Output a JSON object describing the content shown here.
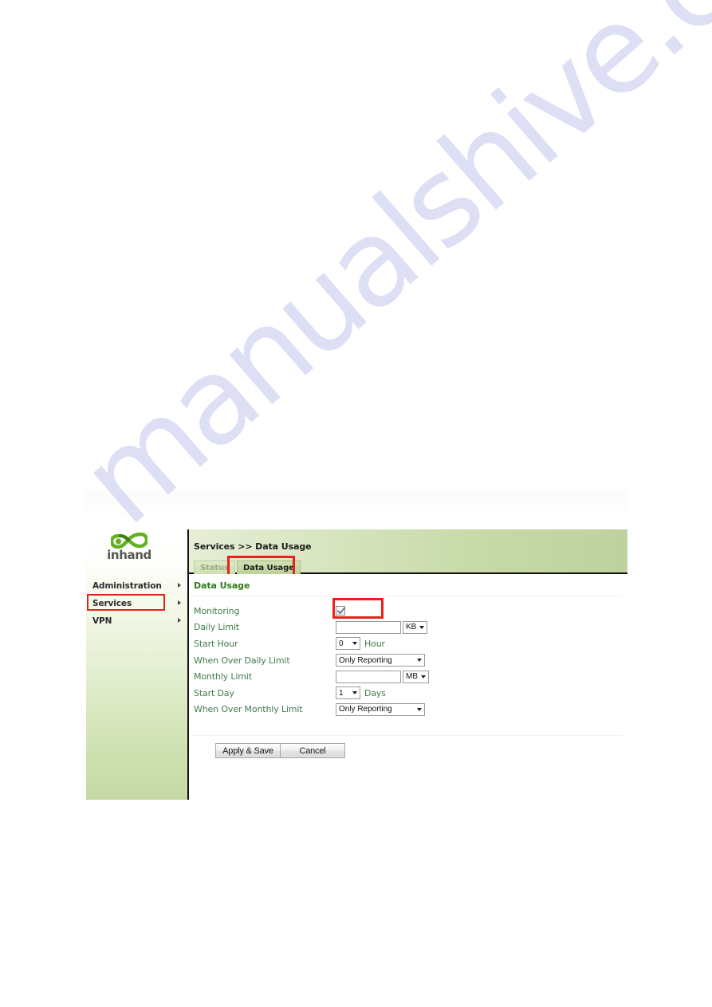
{
  "watermark": {
    "text": "manualshive.com"
  },
  "brand": {
    "name": "inhand",
    "logo_icon": "inhand-infinity-logo-icon",
    "accent_green": "#5aa22a"
  },
  "sidebar": {
    "items": [
      {
        "label": "Administration",
        "selected": false,
        "arrow_icon": "chevron-right-icon"
      },
      {
        "label": "Services",
        "selected": true,
        "arrow_icon": "chevron-right-icon"
      },
      {
        "label": "VPN",
        "selected": false,
        "arrow_icon": "chevron-right-icon"
      }
    ],
    "highlight_color": "#e8221b"
  },
  "main": {
    "breadcrumb": "Services >> Data Usage",
    "tabs": [
      {
        "label": "Status",
        "active": false
      },
      {
        "label": "Data Usage",
        "active": true
      }
    ],
    "tab_highlight_color": "#e8221b",
    "section_title": "Data Usage",
    "form": {
      "monitoring": {
        "label": "Monitoring",
        "checked": true,
        "check_icon": "checkmark-icon",
        "highlight_color": "#e8221b"
      },
      "daily_limit": {
        "label": "Daily Limit",
        "value": "",
        "unit": "KB",
        "unit_caret_icon": "caret-down-icon"
      },
      "start_hour": {
        "label": "Start Hour",
        "value": "0",
        "suffix": "Hour",
        "caret_icon": "caret-down-icon"
      },
      "when_over_daily_limit": {
        "label": "When Over Daily Limit",
        "value": "Only Reporting",
        "caret_icon": "caret-down-icon"
      },
      "monthly_limit": {
        "label": "Monthly Limit",
        "value": "",
        "unit": "MB",
        "unit_caret_icon": "caret-down-icon"
      },
      "start_day": {
        "label": "Start Day",
        "value": "1",
        "suffix": "Days",
        "caret_icon": "caret-down-icon"
      },
      "when_over_monthly_limit": {
        "label": "When Over Monthly Limit",
        "value": "Only Reporting",
        "caret_icon": "caret-down-icon"
      }
    },
    "buttons": {
      "apply_save": "Apply & Save",
      "cancel": "Cancel"
    }
  }
}
